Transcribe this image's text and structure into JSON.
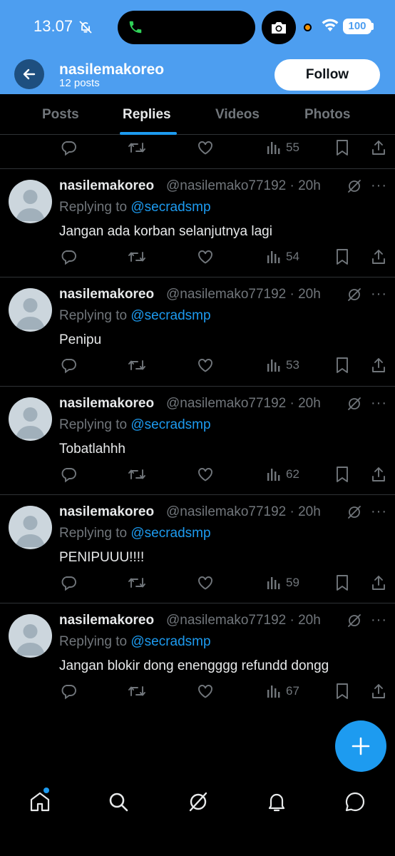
{
  "status_bar": {
    "time": "13.07",
    "battery": "100"
  },
  "profile": {
    "name": "nasilemakoreo",
    "posts_count": "12 posts",
    "follow_label": "Follow"
  },
  "tabs": [
    {
      "label": "Posts",
      "active": false
    },
    {
      "label": "Replies",
      "active": true
    },
    {
      "label": "Videos",
      "active": false
    },
    {
      "label": "Photos",
      "active": false
    }
  ],
  "top_partial": {
    "views": "55"
  },
  "tweets": [
    {
      "name": "nasilemakoreo",
      "handle_time": "@nasilemako77192 · 20h",
      "replying_prefix": "Replying to",
      "replying_to": "@secradsmp",
      "text": "Jangan ada korban selanjutnya lagi",
      "views": "54"
    },
    {
      "name": "nasilemakoreo",
      "handle_time": "@nasilemako77192 · 20h",
      "replying_prefix": "Replying to",
      "replying_to": "@secradsmp",
      "text": "Penipu",
      "views": "53"
    },
    {
      "name": "nasilemakoreo",
      "handle_time": "@nasilemako77192 · 20h",
      "replying_prefix": "Replying to",
      "replying_to": "@secradsmp",
      "text": "Tobatlahhh",
      "views": "62"
    },
    {
      "name": "nasilemakoreo",
      "handle_time": "@nasilemako77192 · 20h",
      "replying_prefix": "Replying to",
      "replying_to": "@secradsmp",
      "text": "PENIPUUU!!!!",
      "views": "59"
    },
    {
      "name": "nasilemakoreo",
      "handle_time": "@nasilemako77192 · 20h",
      "replying_prefix": "Replying to",
      "replying_to": "@secradsmp",
      "text": "Jangan blokir dong enengggg refundd dongg",
      "views": "67"
    }
  ],
  "icons": {
    "status": [
      "bell-off-icon",
      "phone-icon",
      "camera-icon",
      "wifi-icon",
      "battery-icon"
    ],
    "tweet_actions": [
      "reply-icon",
      "retweet-icon",
      "like-icon",
      "views-icon",
      "bookmark-icon",
      "share-icon"
    ],
    "bottom_nav": [
      "home-icon",
      "search-icon",
      "grok-icon",
      "notifications-icon",
      "messages-icon"
    ],
    "fab": "plus-icon"
  },
  "colors": {
    "header_bg": "#4d9ef0",
    "accent": "#1d9bf0",
    "muted_text": "#71767b",
    "background": "#000000"
  }
}
